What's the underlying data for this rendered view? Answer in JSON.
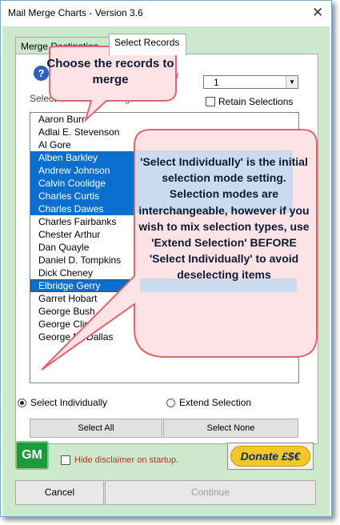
{
  "window": {
    "title": "Mail Merge Charts - Version 3.6",
    "close_glyph": "✕"
  },
  "tabs": [
    {
      "label": "Merge Destination",
      "active": false
    },
    {
      "label": "Select Records",
      "active": true
    }
  ],
  "header": {
    "help_glyph": "?",
    "column_label": "Display Worksheet Column #",
    "column_value": "1",
    "select_label": "Select Records to Merge",
    "retain_label": "Retain Selections",
    "retain_checked": false
  },
  "records": [
    {
      "name": "Aaron Burr",
      "selected": false
    },
    {
      "name": "Adlai E. Stevenson",
      "selected": false
    },
    {
      "name": "Al Gore",
      "selected": false
    },
    {
      "name": "Alben Barkley",
      "selected": true
    },
    {
      "name": "Andrew Johnson",
      "selected": true
    },
    {
      "name": "Calvin Coolidge",
      "selected": true
    },
    {
      "name": "Charles Curtis",
      "selected": true
    },
    {
      "name": "Charles Dawes",
      "selected": true
    },
    {
      "name": "Charles Fairbanks",
      "selected": false
    },
    {
      "name": "Chester Arthur",
      "selected": false
    },
    {
      "name": "Dan Quayle",
      "selected": false
    },
    {
      "name": "Daniel D. Tompkins",
      "selected": false
    },
    {
      "name": "Dick Cheney",
      "selected": false
    },
    {
      "name": "Elbridge Gerry",
      "selected": true,
      "focused": true
    },
    {
      "name": "Garret Hobart",
      "selected": false
    },
    {
      "name": "George Bush",
      "selected": false
    },
    {
      "name": "George Clinton",
      "selected": false
    },
    {
      "name": "George M. Dallas",
      "selected": false
    }
  ],
  "modes": {
    "individual_label": "Select Individually",
    "extend_label": "Extend Selection",
    "selected": "individual"
  },
  "buttons": {
    "select_all": "Select All",
    "select_none": "Select None",
    "gm": "GM",
    "disclaimer": "Hide disclaimer on startup.",
    "donate": "Donate £$€",
    "cancel": "Cancel",
    "continue": "Continue"
  },
  "callouts": {
    "small": "Choose the records to merge",
    "large": "'Select Individually' is the initial selection mode setting. Selection modes are interchangeable, however if you wish to mix selection types, use 'Extend Selection' BEFORE 'Select Individually' to avoid deselecting items"
  },
  "colors": {
    "client_bg": "#cde8cd",
    "selection": "#0a6fcf",
    "callout_fill": "#fde3e5",
    "callout_border": "#e3646c",
    "callout_highlight": "#b3d6f4",
    "donate_fill": "#f4c62a",
    "gm_fill": "#1f9a3a"
  }
}
